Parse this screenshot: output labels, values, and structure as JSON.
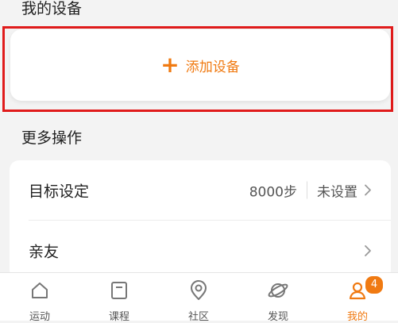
{
  "devices_section": {
    "title": "我的设备",
    "add_button": {
      "plus": "+",
      "label": "添加设备"
    }
  },
  "more_section": {
    "title": "更多操作",
    "items": [
      {
        "label": "目标设定",
        "value": "8000步",
        "status": "未设置"
      },
      {
        "label": "亲友"
      }
    ]
  },
  "tabbar": {
    "tabs": [
      {
        "label": "运动",
        "icon": "home-icon"
      },
      {
        "label": "课程",
        "icon": "course-icon"
      },
      {
        "label": "社区",
        "icon": "location-pin-icon"
      },
      {
        "label": "发现",
        "icon": "planet-icon"
      },
      {
        "label": "我的",
        "icon": "person-icon",
        "badge": "4",
        "active": true
      }
    ]
  },
  "colors": {
    "accent": "#f07a12",
    "highlight_border": "#e01b1b"
  }
}
